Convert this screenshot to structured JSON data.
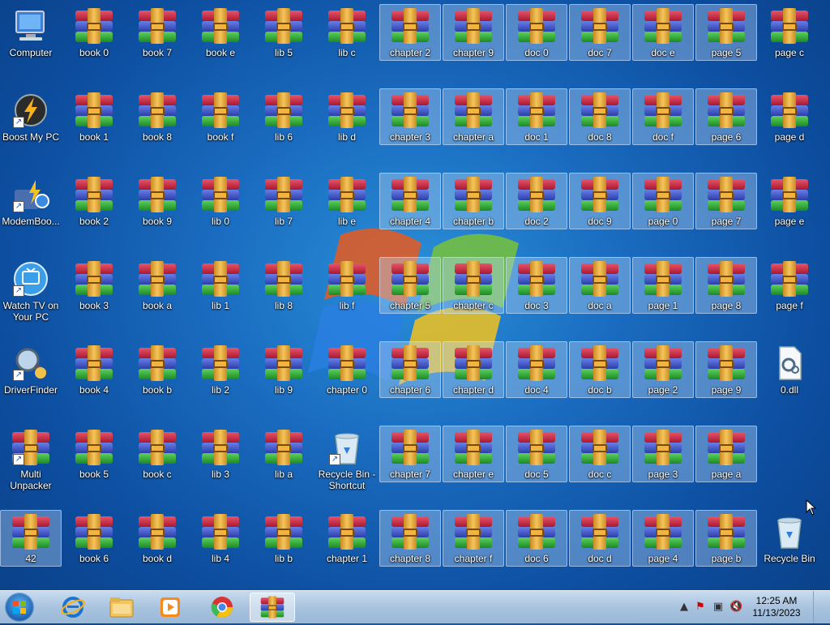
{
  "desktop": {
    "icons": [
      {
        "label": "Computer",
        "kind": "computer",
        "col": 0,
        "row": 0,
        "selected": false
      },
      {
        "label": "Boost My PC",
        "kind": "boost",
        "col": 0,
        "row": 1,
        "selected": false,
        "shortcut": true
      },
      {
        "label": "ModemBoo...",
        "kind": "modem",
        "col": 0,
        "row": 2,
        "selected": false,
        "shortcut": true
      },
      {
        "label": "Watch TV on Your PC",
        "kind": "tv",
        "col": 0,
        "row": 3,
        "selected": false,
        "shortcut": true,
        "two": true
      },
      {
        "label": "DriverFinder",
        "kind": "driver",
        "col": 0,
        "row": 4,
        "selected": false,
        "shortcut": true
      },
      {
        "label": "Multi Unpacker",
        "kind": "rar",
        "col": 0,
        "row": 5,
        "selected": false,
        "shortcut": true,
        "two": true
      },
      {
        "label": "42",
        "kind": "rar",
        "col": 0,
        "row": 6,
        "selected": true
      },
      {
        "label": "book 0",
        "kind": "rar",
        "col": 1,
        "row": 0,
        "selected": false
      },
      {
        "label": "book 1",
        "kind": "rar",
        "col": 1,
        "row": 1,
        "selected": false
      },
      {
        "label": "book 2",
        "kind": "rar",
        "col": 1,
        "row": 2,
        "selected": false
      },
      {
        "label": "book 3",
        "kind": "rar",
        "col": 1,
        "row": 3,
        "selected": false
      },
      {
        "label": "book 4",
        "kind": "rar",
        "col": 1,
        "row": 4,
        "selected": false
      },
      {
        "label": "book 5",
        "kind": "rar",
        "col": 1,
        "row": 5,
        "selected": false
      },
      {
        "label": "book 6",
        "kind": "rar",
        "col": 1,
        "row": 6,
        "selected": false
      },
      {
        "label": "book 7",
        "kind": "rar",
        "col": 2,
        "row": 0,
        "selected": false
      },
      {
        "label": "book 8",
        "kind": "rar",
        "col": 2,
        "row": 1,
        "selected": false
      },
      {
        "label": "book 9",
        "kind": "rar",
        "col": 2,
        "row": 2,
        "selected": false
      },
      {
        "label": "book a",
        "kind": "rar",
        "col": 2,
        "row": 3,
        "selected": false
      },
      {
        "label": "book b",
        "kind": "rar",
        "col": 2,
        "row": 4,
        "selected": false
      },
      {
        "label": "book c",
        "kind": "rar",
        "col": 2,
        "row": 5,
        "selected": false
      },
      {
        "label": "book d",
        "kind": "rar",
        "col": 2,
        "row": 6,
        "selected": false
      },
      {
        "label": "book e",
        "kind": "rar",
        "col": 3,
        "row": 0,
        "selected": false
      },
      {
        "label": "book f",
        "kind": "rar",
        "col": 3,
        "row": 1,
        "selected": false
      },
      {
        "label": "lib 0",
        "kind": "rar",
        "col": 3,
        "row": 2,
        "selected": false
      },
      {
        "label": "lib 1",
        "kind": "rar",
        "col": 3,
        "row": 3,
        "selected": false
      },
      {
        "label": "lib 2",
        "kind": "rar",
        "col": 3,
        "row": 4,
        "selected": false
      },
      {
        "label": "lib 3",
        "kind": "rar",
        "col": 3,
        "row": 5,
        "selected": false
      },
      {
        "label": "lib 4",
        "kind": "rar",
        "col": 3,
        "row": 6,
        "selected": false
      },
      {
        "label": "lib 5",
        "kind": "rar",
        "col": 4,
        "row": 0,
        "selected": false
      },
      {
        "label": "lib 6",
        "kind": "rar",
        "col": 4,
        "row": 1,
        "selected": false
      },
      {
        "label": "lib 7",
        "kind": "rar",
        "col": 4,
        "row": 2,
        "selected": false
      },
      {
        "label": "lib 8",
        "kind": "rar",
        "col": 4,
        "row": 3,
        "selected": false
      },
      {
        "label": "lib 9",
        "kind": "rar",
        "col": 4,
        "row": 4,
        "selected": false
      },
      {
        "label": "lib a",
        "kind": "rar",
        "col": 4,
        "row": 5,
        "selected": false
      },
      {
        "label": "lib b",
        "kind": "rar",
        "col": 4,
        "row": 6,
        "selected": false
      },
      {
        "label": "lib c",
        "kind": "rar",
        "col": 5,
        "row": 0,
        "selected": false
      },
      {
        "label": "lib d",
        "kind": "rar",
        "col": 5,
        "row": 1,
        "selected": false
      },
      {
        "label": "lib e",
        "kind": "rar",
        "col": 5,
        "row": 2,
        "selected": false
      },
      {
        "label": "lib f",
        "kind": "rar",
        "col": 5,
        "row": 3,
        "selected": false
      },
      {
        "label": "chapter 0",
        "kind": "rar",
        "col": 5,
        "row": 4,
        "selected": false
      },
      {
        "label": "Recycle Bin - Shortcut",
        "kind": "bin",
        "col": 5,
        "row": 5,
        "selected": false,
        "shortcut": true,
        "two": true
      },
      {
        "label": "chapter 1",
        "kind": "rar",
        "col": 5,
        "row": 6,
        "selected": false
      },
      {
        "label": "chapter 2",
        "kind": "rar",
        "col": 6,
        "row": 0,
        "selected": true
      },
      {
        "label": "chapter 3",
        "kind": "rar",
        "col": 6,
        "row": 1,
        "selected": true
      },
      {
        "label": "chapter 4",
        "kind": "rar",
        "col": 6,
        "row": 2,
        "selected": true
      },
      {
        "label": "chapter 5",
        "kind": "rar",
        "col": 6,
        "row": 3,
        "selected": true
      },
      {
        "label": "chapter 6",
        "kind": "rar",
        "col": 6,
        "row": 4,
        "selected": true
      },
      {
        "label": "chapter 7",
        "kind": "rar",
        "col": 6,
        "row": 5,
        "selected": true
      },
      {
        "label": "chapter 8",
        "kind": "rar",
        "col": 6,
        "row": 6,
        "selected": true
      },
      {
        "label": "chapter 9",
        "kind": "rar",
        "col": 7,
        "row": 0,
        "selected": true
      },
      {
        "label": "chapter a",
        "kind": "rar",
        "col": 7,
        "row": 1,
        "selected": true
      },
      {
        "label": "chapter b",
        "kind": "rar",
        "col": 7,
        "row": 2,
        "selected": true
      },
      {
        "label": "chapter c",
        "kind": "rar",
        "col": 7,
        "row": 3,
        "selected": true
      },
      {
        "label": "chapter d",
        "kind": "rar",
        "col": 7,
        "row": 4,
        "selected": true
      },
      {
        "label": "chapter e",
        "kind": "rar",
        "col": 7,
        "row": 5,
        "selected": true
      },
      {
        "label": "chapter f",
        "kind": "rar",
        "col": 7,
        "row": 6,
        "selected": true
      },
      {
        "label": "doc 0",
        "kind": "rar",
        "col": 8,
        "row": 0,
        "selected": true
      },
      {
        "label": "doc 1",
        "kind": "rar",
        "col": 8,
        "row": 1,
        "selected": true
      },
      {
        "label": "doc 2",
        "kind": "rar",
        "col": 8,
        "row": 2,
        "selected": true
      },
      {
        "label": "doc 3",
        "kind": "rar",
        "col": 8,
        "row": 3,
        "selected": true
      },
      {
        "label": "doc 4",
        "kind": "rar",
        "col": 8,
        "row": 4,
        "selected": true
      },
      {
        "label": "doc 5",
        "kind": "rar",
        "col": 8,
        "row": 5,
        "selected": true
      },
      {
        "label": "doc 6",
        "kind": "rar",
        "col": 8,
        "row": 6,
        "selected": true
      },
      {
        "label": "doc 7",
        "kind": "rar",
        "col": 9,
        "row": 0,
        "selected": true
      },
      {
        "label": "doc 8",
        "kind": "rar",
        "col": 9,
        "row": 1,
        "selected": true
      },
      {
        "label": "doc 9",
        "kind": "rar",
        "col": 9,
        "row": 2,
        "selected": true
      },
      {
        "label": "doc a",
        "kind": "rar",
        "col": 9,
        "row": 3,
        "selected": true
      },
      {
        "label": "doc b",
        "kind": "rar",
        "col": 9,
        "row": 4,
        "selected": true
      },
      {
        "label": "doc c",
        "kind": "rar",
        "col": 9,
        "row": 5,
        "selected": true
      },
      {
        "label": "doc d",
        "kind": "rar",
        "col": 9,
        "row": 6,
        "selected": true
      },
      {
        "label": "doc e",
        "kind": "rar",
        "col": 10,
        "row": 0,
        "selected": true
      },
      {
        "label": "doc f",
        "kind": "rar",
        "col": 10,
        "row": 1,
        "selected": true
      },
      {
        "label": "page 0",
        "kind": "rar",
        "col": 10,
        "row": 2,
        "selected": true
      },
      {
        "label": "page 1",
        "kind": "rar",
        "col": 10,
        "row": 3,
        "selected": true
      },
      {
        "label": "page 2",
        "kind": "rar",
        "col": 10,
        "row": 4,
        "selected": true
      },
      {
        "label": "page 3",
        "kind": "rar",
        "col": 10,
        "row": 5,
        "selected": true
      },
      {
        "label": "page 4",
        "kind": "rar",
        "col": 10,
        "row": 6,
        "selected": true
      },
      {
        "label": "page 5",
        "kind": "rar",
        "col": 11,
        "row": 0,
        "selected": true
      },
      {
        "label": "page 6",
        "kind": "rar",
        "col": 11,
        "row": 1,
        "selected": true
      },
      {
        "label": "page 7",
        "kind": "rar",
        "col": 11,
        "row": 2,
        "selected": true
      },
      {
        "label": "page 8",
        "kind": "rar",
        "col": 11,
        "row": 3,
        "selected": true
      },
      {
        "label": "page 9",
        "kind": "rar",
        "col": 11,
        "row": 4,
        "selected": true
      },
      {
        "label": "page a",
        "kind": "rar",
        "col": 11,
        "row": 5,
        "selected": true
      },
      {
        "label": "page b",
        "kind": "rar",
        "col": 11,
        "row": 6,
        "selected": true
      },
      {
        "label": "page c",
        "kind": "rar",
        "col": 12,
        "row": 0,
        "selected": false
      },
      {
        "label": "page d",
        "kind": "rar",
        "col": 12,
        "row": 1,
        "selected": false
      },
      {
        "label": "page e",
        "kind": "rar",
        "col": 12,
        "row": 2,
        "selected": false
      },
      {
        "label": "page f",
        "kind": "rar",
        "col": 12,
        "row": 3,
        "selected": false
      },
      {
        "label": "0.dll",
        "kind": "dll",
        "col": 12,
        "row": 4,
        "selected": false
      },
      {
        "label": "Recycle Bin",
        "kind": "bin",
        "col": 12,
        "row": 6,
        "selected": false
      }
    ]
  },
  "taskbar": {
    "pinned": [
      {
        "name": "internet-explorer",
        "active": false
      },
      {
        "name": "windows-explorer",
        "active": false
      },
      {
        "name": "media-player",
        "active": false
      },
      {
        "name": "chrome",
        "active": false
      },
      {
        "name": "winrar",
        "active": true
      }
    ],
    "tray_icons": [
      "show-hidden-icons",
      "action-center-flag-icon",
      "network-icon",
      "volume-muted-icon"
    ],
    "clock_time": "12:25 AM",
    "clock_date": "11/13/2023"
  }
}
